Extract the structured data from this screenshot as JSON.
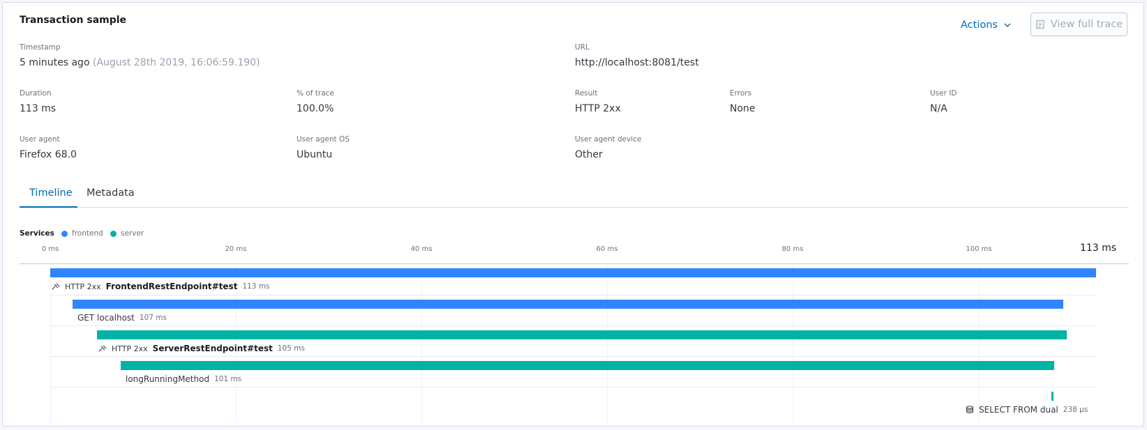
{
  "header": {
    "title": "Transaction sample",
    "actions_label": "Actions",
    "view_trace_label": "View full trace"
  },
  "summary": {
    "timestamp": {
      "label": "Timestamp",
      "value": "5 minutes ago",
      "detail": "(August 28th 2019, 16:06:59.190)"
    },
    "url": {
      "label": "URL",
      "value": "http://localhost:8081/test"
    },
    "duration": {
      "label": "Duration",
      "value": "113 ms"
    },
    "pct_trace": {
      "label": "% of trace",
      "value": "100.0%"
    },
    "result": {
      "label": "Result",
      "value": "HTTP 2xx"
    },
    "errors": {
      "label": "Errors",
      "value": "None"
    },
    "user_id": {
      "label": "User ID",
      "value": "N/A"
    },
    "user_agent": {
      "label": "User agent",
      "value": "Firefox 68.0"
    },
    "user_agent_os": {
      "label": "User agent OS",
      "value": "Ubuntu"
    },
    "user_agent_device": {
      "label": "User agent device",
      "value": "Other"
    }
  },
  "tabs": [
    {
      "label": "Timeline",
      "active": true
    },
    {
      "label": "Metadata",
      "active": false
    }
  ],
  "timeline": {
    "services_label": "Services",
    "services": [
      {
        "name": "frontend",
        "color": "#3185fc"
      },
      {
        "name": "server",
        "color": "#00b3a4"
      }
    ],
    "ticks": [
      "0 ms",
      "20 ms",
      "40 ms",
      "60 ms",
      "80 ms",
      "100 ms"
    ],
    "end_label": "113 ms",
    "spans": [
      {
        "type": "transaction",
        "icon": "transaction-icon",
        "status": "HTTP 2xx",
        "name": "FrontendRestEndpoint#test",
        "duration": "113 ms",
        "service": "frontend"
      },
      {
        "type": "span",
        "name": "GET localhost",
        "duration": "107 ms",
        "service": "frontend"
      },
      {
        "type": "transaction",
        "icon": "transaction-icon",
        "status": "HTTP 2xx",
        "name": "ServerRestEndpoint#test",
        "duration": "105 ms",
        "service": "server"
      },
      {
        "type": "span",
        "name": "longRunningMethod",
        "duration": "101 ms",
        "service": "server"
      },
      {
        "type": "span",
        "icon": "database-icon",
        "name": "SELECT FROM dual",
        "duration": "238 μs",
        "service": "server"
      }
    ]
  }
}
